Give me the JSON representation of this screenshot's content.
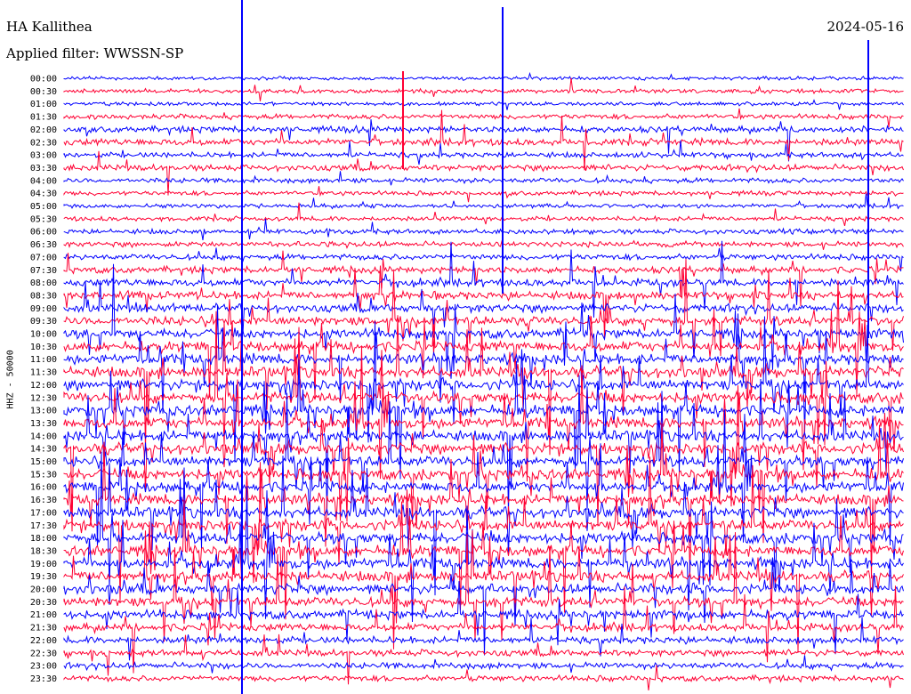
{
  "header": {
    "station": "HA Kallithea",
    "date": "2024-05-16",
    "filter": "Applied filter: WWSSN-SP"
  },
  "chart_data": {
    "type": "line",
    "title": "HA Kallithea",
    "subtitle": "Applied filter: WWSSN-SP",
    "ylabel": "HHZ - 50000",
    "xlabel": "",
    "grid": false,
    "trace_colors": [
      "#0000ff",
      "#ff0033"
    ],
    "rows": [
      "00:00",
      "00:30",
      "01:00",
      "01:30",
      "02:00",
      "02:30",
      "03:00",
      "03:30",
      "04:00",
      "04:30",
      "05:00",
      "05:30",
      "06:00",
      "06:30",
      "07:00",
      "07:30",
      "08:00",
      "08:30",
      "09:00",
      "09:30",
      "10:00",
      "10:30",
      "11:00",
      "11:30",
      "12:00",
      "12:30",
      "13:00",
      "13:30",
      "14:00",
      "14:30",
      "15:00",
      "15:30",
      "16:00",
      "16:30",
      "17:00",
      "17:30",
      "18:00",
      "18:30",
      "19:00",
      "19:30",
      "20:00",
      "20:30",
      "21:00",
      "21:30",
      "22:00",
      "22:30",
      "23:00",
      "23:30"
    ],
    "relative_activity": [
      0.12,
      0.2,
      0.12,
      0.3,
      0.45,
      0.5,
      0.35,
      0.45,
      0.3,
      0.25,
      0.2,
      0.25,
      0.3,
      0.35,
      0.4,
      0.5,
      0.6,
      0.65,
      0.7,
      0.8,
      0.85,
      0.9,
      0.95,
      1.0,
      1.0,
      1.0,
      1.0,
      1.0,
      1.0,
      1.0,
      1.0,
      1.0,
      1.0,
      1.0,
      1.0,
      1.0,
      1.0,
      1.0,
      1.0,
      0.95,
      0.9,
      0.85,
      0.75,
      0.6,
      0.55,
      0.5,
      0.45,
      0.4
    ]
  }
}
